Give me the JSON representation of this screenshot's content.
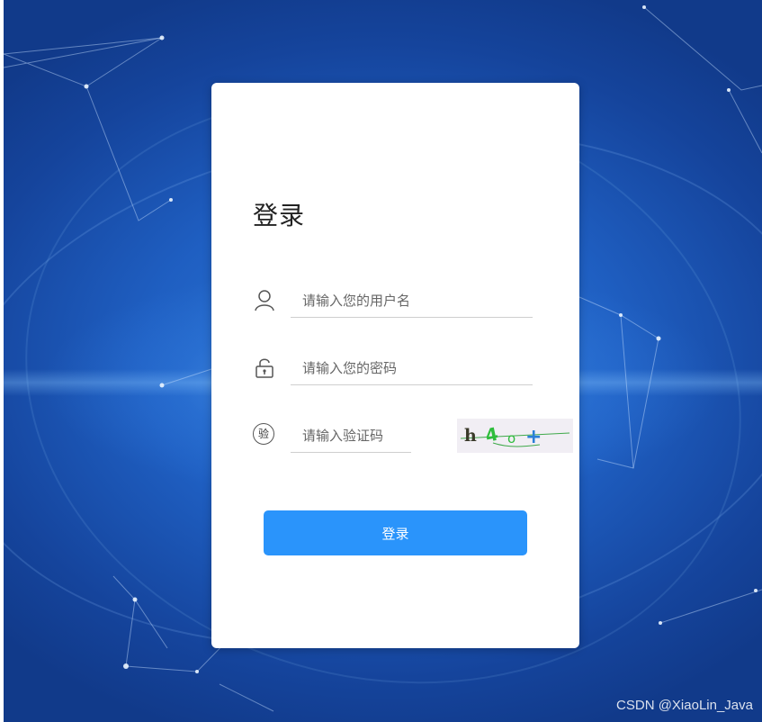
{
  "login": {
    "title": "登录",
    "username_placeholder": "请输入您的用户名",
    "password_placeholder": "请输入您的密码",
    "captcha_placeholder": "请输入验证码",
    "verify_icon_text": "验",
    "captcha_text": "h 4 o +",
    "submit_label": "登录"
  },
  "watermark": "CSDN @XiaoLin_Java",
  "colors": {
    "button": "#2a94fb",
    "background": "#1f5fc2",
    "card": "#ffffff"
  },
  "icons": {
    "username": "user-icon",
    "password": "lock-icon",
    "captcha": "verify-icon"
  }
}
